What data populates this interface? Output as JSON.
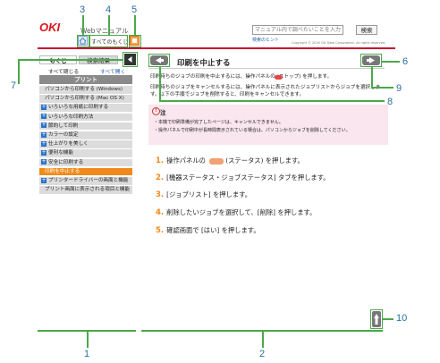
{
  "header": {
    "logo": "OKI",
    "title": "Webマニュアル",
    "toc_label": "すべてのもくじ",
    "search_placeholder": "マニュアル内で調べたいことを入力",
    "search_button": "検索",
    "search_tips": "検索のヒント",
    "copyright": "Copyright © 2016 Oki Data Corporation. All rights reserved."
  },
  "sidebar": {
    "tabs": [
      "もくじ",
      "検索結果"
    ],
    "collapse_all": "すべて閉じる",
    "expand_all": "すべて開く",
    "section": "プリント",
    "items": [
      {
        "label": "パソコンから印刷する (Windows)",
        "has_plus": false,
        "active": false
      },
      {
        "label": "パソコンから印刷する (Mac OS X)",
        "has_plus": false,
        "active": false
      },
      {
        "label": "いろいろな用紙に印刷する",
        "has_plus": true,
        "active": false
      },
      {
        "label": "いろいろな印刷方法",
        "has_plus": true,
        "active": false
      },
      {
        "label": "節約して印刷",
        "has_plus": true,
        "active": false
      },
      {
        "label": "カラーの設定",
        "has_plus": true,
        "active": false
      },
      {
        "label": "仕上がりを美しく",
        "has_plus": true,
        "active": false
      },
      {
        "label": "便利な機能",
        "has_plus": true,
        "active": false
      },
      {
        "label": "安全に印刷する",
        "has_plus": true,
        "active": false
      },
      {
        "label": "印刷を中止する",
        "has_plus": false,
        "active": true
      },
      {
        "label": "プリンタードライバーの画面と機能",
        "has_plus": true,
        "active": false
      },
      {
        "label": "プリント画面に表示される項目と機能",
        "has_plus": false,
        "active": false
      }
    ]
  },
  "content": {
    "page_title": "印刷を中止する",
    "intro_line1": "印刷待ちのジョブの印刷を中止するには、操作パネルの (ストップ) を押します。",
    "intro_line2": "印刷待ちのジョブをキャンセルするには、操作パネルに表示されたジョブリストからジョブを選択します。以下の手順でジョブを削除すると、印刷をキャンセルできます。",
    "note_title": "注",
    "note_items": [
      "本機で印刷準備が完了したページは、キャンセルできません。",
      "操作パネルで印刷中が長時間表示されている場合は、パソコンからジョブを削除してください。"
    ],
    "steps": [
      {
        "num": "1.",
        "pre": "操作パネルの",
        "post": "(ステータス) を押します。",
        "has_button": true
      },
      {
        "num": "2.",
        "pre": "[機器ステータス・ジョブステータス] タブを押します。",
        "post": "",
        "has_button": false
      },
      {
        "num": "3.",
        "pre": "[ジョブリスト] を押します。",
        "post": "",
        "has_button": false
      },
      {
        "num": "4.",
        "pre": "削除したいジョブを選択して、[削除] を押します。",
        "post": "",
        "has_button": false
      },
      {
        "num": "5.",
        "pre": "確認画面で [はい] を押します。",
        "post": "",
        "has_button": false
      }
    ]
  },
  "callouts": [
    "1",
    "2",
    "3",
    "4",
    "5",
    "6",
    "7",
    "8",
    "9",
    "10"
  ],
  "colors": {
    "brand_red": "#d9141b",
    "accent_orange": "#f08a1a",
    "callout_green": "#4aa84a",
    "note_pink": "#f9e6ee",
    "sidebar_gray": "#dcdcdc",
    "section_gray": "#8a8a8a"
  },
  "icons": [
    "home-icon",
    "help-icon",
    "collapse-arrow-icon",
    "prev-arrow-icon",
    "next-arrow-icon",
    "scroll-top-icon",
    "stop-icon"
  ]
}
